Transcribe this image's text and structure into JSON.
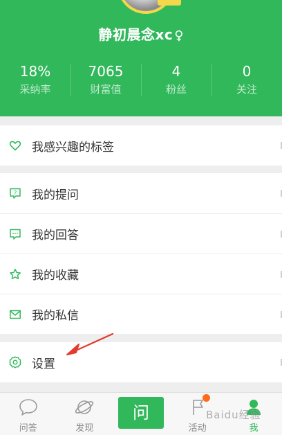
{
  "profile": {
    "username": "静初晨念xc",
    "gender_symbol": "♀"
  },
  "stats": [
    {
      "value": "18%",
      "label": "采纳率"
    },
    {
      "value": "7065",
      "label": "财富值"
    },
    {
      "value": "4",
      "label": "粉丝"
    },
    {
      "value": "0",
      "label": "关注"
    }
  ],
  "menu": {
    "interests": {
      "label": "我感兴趣的标签",
      "icon": "heart-icon"
    },
    "questions": {
      "label": "我的提问",
      "icon": "question-icon"
    },
    "answers": {
      "label": "我的回答",
      "icon": "comment-icon"
    },
    "favorites": {
      "label": "我的收藏",
      "icon": "star-icon"
    },
    "messages": {
      "label": "我的私信",
      "icon": "mail-icon"
    },
    "settings": {
      "label": "设置",
      "icon": "gear-icon"
    }
  },
  "tabs": [
    {
      "label": "问答",
      "icon": "speech-bubble-icon"
    },
    {
      "label": "发现",
      "icon": "planet-icon"
    },
    {
      "label": "问",
      "icon": "ask-button"
    },
    {
      "label": "活动",
      "icon": "flag-icon"
    },
    {
      "label": "我",
      "icon": "person-icon"
    }
  ],
  "watermark": "Baidu经验",
  "colors": {
    "brand_green": "#31b85b",
    "badge_orange": "#ff6b1a",
    "annotation_red": "#e33b2e"
  }
}
